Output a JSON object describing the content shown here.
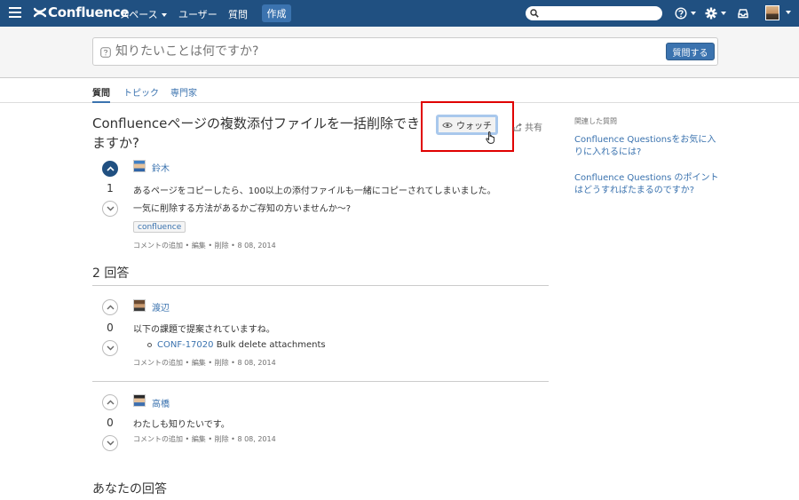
{
  "topnav": {
    "logo": "Confluence",
    "spaces": "スペース",
    "users": "ユーザー",
    "questions": "質問",
    "create": "作成",
    "search_placeholder": ""
  },
  "ask": {
    "placeholder": "知りたいことは何ですか?",
    "button": "質問する"
  },
  "tabs": [
    {
      "label": "質問"
    },
    {
      "label": "トピック"
    },
    {
      "label": "専門家"
    }
  ],
  "question": {
    "title": "Confluenceページの複数添付ファイルを一括削除できますか?",
    "watch": "ウォッチ",
    "share": "共有",
    "votes": "1",
    "author": "鈴木",
    "line1": "あるページをコピーしたら、100以上の添付ファイルも一緒にコピーされてしまいました。",
    "line2": "一気に削除する方法があるかご存知の方いませんか〜?",
    "label": "confluence",
    "meta": {
      "comment": "コメントの追加",
      "edit": "編集",
      "delete": "削除",
      "date": "8 08, 2014"
    }
  },
  "answers_heading": "2 回答",
  "answers": [
    {
      "votes": "0",
      "author": "渡辺",
      "text": "以下の課題で提案されていますね。",
      "issue_key": "CONF-17020",
      "issue_title": " Bulk delete attachments",
      "meta": {
        "comment": "コメントの追加",
        "edit": "編集",
        "delete": "削除",
        "date": "8 08, 2014"
      }
    },
    {
      "votes": "0",
      "author": "高橋",
      "text": "わたしも知りたいです。",
      "meta": {
        "comment": "コメントの追加",
        "edit": "編集",
        "delete": "削除",
        "date": "8 08, 2014"
      }
    }
  ],
  "your_answer": "あなたの回答",
  "sidebar": {
    "title": "関連した質問",
    "links": [
      {
        "text": "Confluence Questionsをお気に入りに入れるには?"
      },
      {
        "text": "Confluence Questions のポイントはどうすればたまるのですか?"
      }
    ]
  },
  "colors": {
    "nav": "#205081",
    "accent": "#3b73af",
    "highlight": "#e00000"
  }
}
